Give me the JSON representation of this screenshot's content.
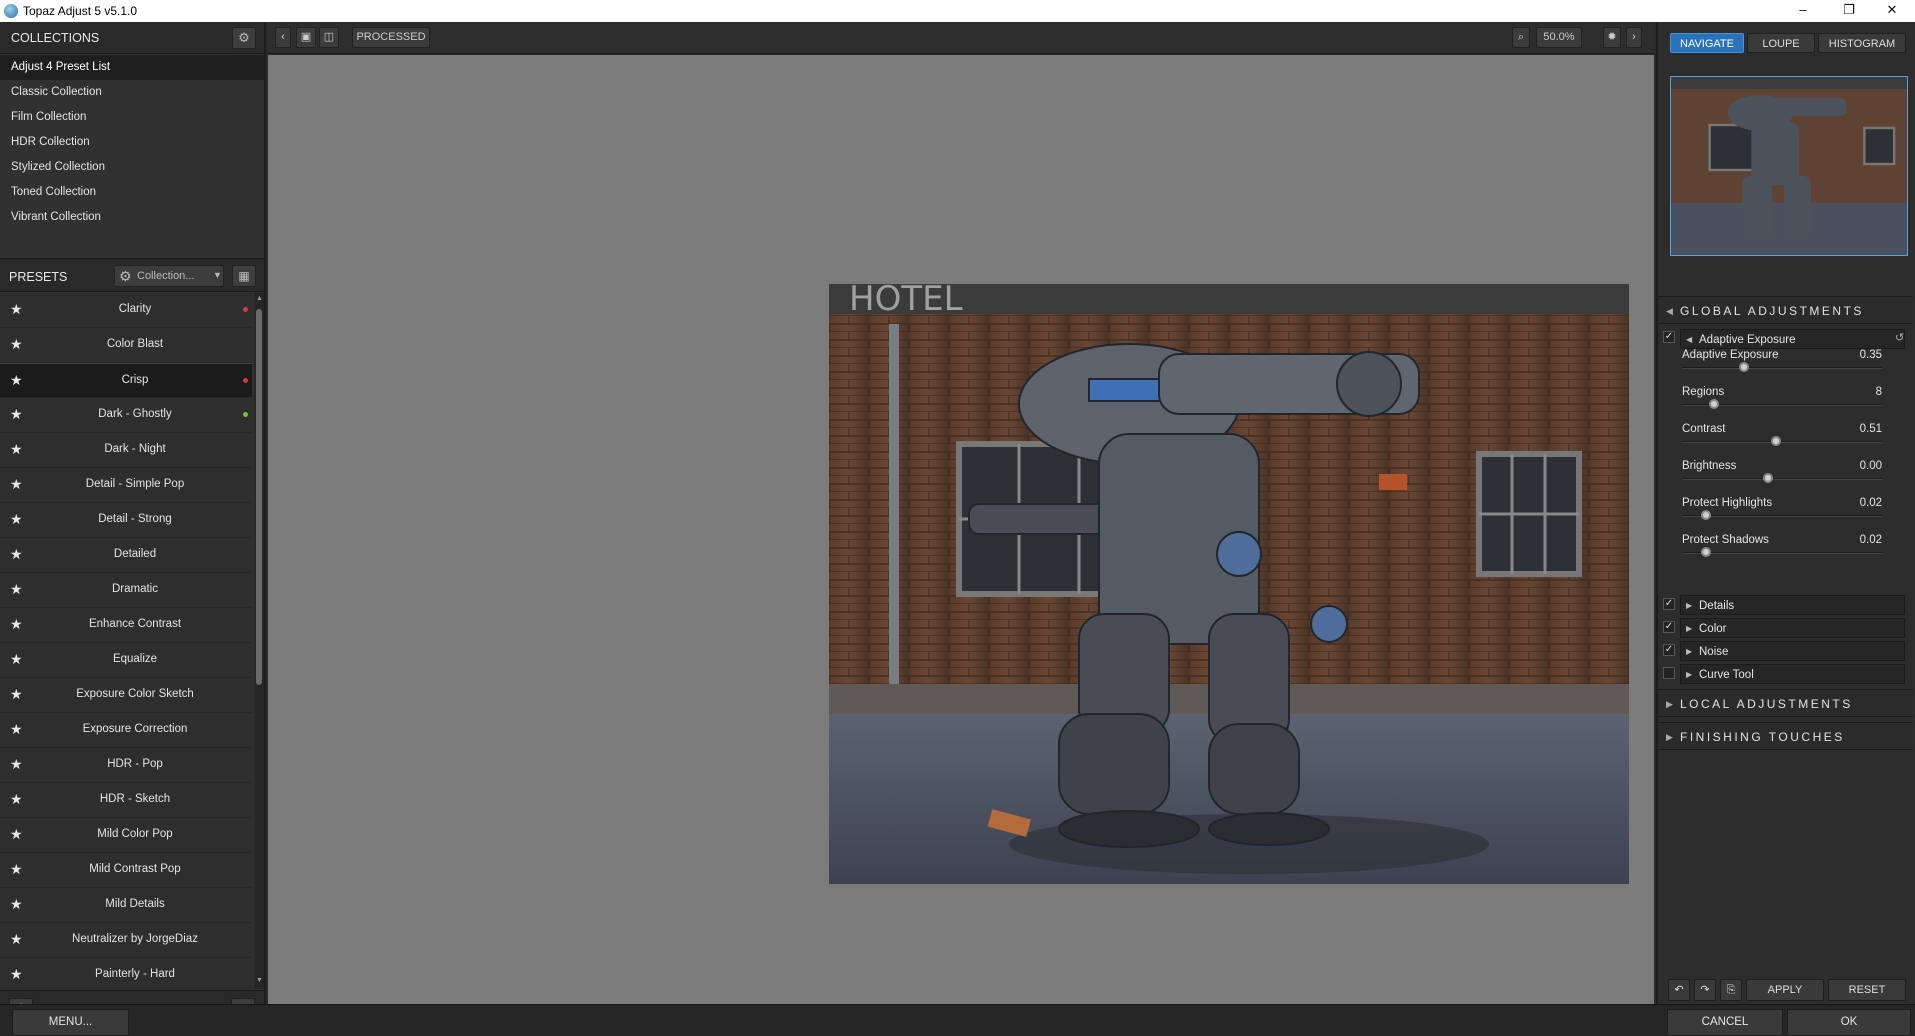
{
  "window": {
    "title": "Topaz Adjust 5 v5.1.0",
    "minimize": "–",
    "maximize": "❐",
    "close": "✕"
  },
  "collections": {
    "header": "COLLECTIONS",
    "items": [
      "Adjust 4 Preset List",
      "Classic Collection",
      "Film Collection",
      "HDR Collection",
      "Stylized Collection",
      "Toned Collection",
      "Vibrant Collection"
    ],
    "selected": "Adjust 4 Preset List"
  },
  "presets": {
    "header": "PRESETS",
    "filter_label": "Collection...",
    "items": [
      {
        "name": "Clarity",
        "dot": "#d43a3a"
      },
      {
        "name": "Color Blast",
        "dot": ""
      },
      {
        "name": "Crisp",
        "dot": "#d43a3a",
        "selected": true
      },
      {
        "name": "Dark - Ghostly",
        "dot": "#7ac143"
      },
      {
        "name": "Dark - Night",
        "dot": ""
      },
      {
        "name": "Detail - Simple Pop",
        "dot": ""
      },
      {
        "name": "Detail - Strong",
        "dot": ""
      },
      {
        "name": "Detailed",
        "dot": ""
      },
      {
        "name": "Dramatic",
        "dot": ""
      },
      {
        "name": "Enhance Contrast",
        "dot": ""
      },
      {
        "name": "Equalize",
        "dot": ""
      },
      {
        "name": "Exposure Color Sketch",
        "dot": ""
      },
      {
        "name": "Exposure Correction",
        "dot": ""
      },
      {
        "name": "HDR - Pop",
        "dot": ""
      },
      {
        "name": "HDR - Sketch",
        "dot": ""
      },
      {
        "name": "Mild Color Pop",
        "dot": ""
      },
      {
        "name": "Mild Contrast Pop",
        "dot": ""
      },
      {
        "name": "Mild Details",
        "dot": ""
      },
      {
        "name": "Neutralizer by JorgeDiaz",
        "dot": ""
      },
      {
        "name": "Painterly - Hard",
        "dot": ""
      }
    ]
  },
  "toolbar": {
    "mode_label": "PROCESSED",
    "zoom": "50.0%"
  },
  "right_tabs": [
    "NAVIGATE",
    "LOUPE",
    "HISTOGRAM"
  ],
  "global_adjustments": {
    "header": "GLOBAL ADJUSTMENTS",
    "adaptive_exposure": {
      "title": "Adaptive Exposure",
      "sliders": [
        {
          "label": "Adaptive Exposure",
          "value": "0.35",
          "pos": 0.31
        },
        {
          "label": "Regions",
          "value": "8",
          "pos": 0.16
        },
        {
          "label": "Contrast",
          "value": "0.51",
          "pos": 0.47
        },
        {
          "label": "Brightness",
          "value": "0.00",
          "pos": 0.43
        },
        {
          "label": "Protect Highlights",
          "value": "0.02",
          "pos": 0.12
        },
        {
          "label": "Protect Shadows",
          "value": "0.02",
          "pos": 0.12
        }
      ]
    },
    "subsections": [
      {
        "label": "Details",
        "checked": true
      },
      {
        "label": "Color",
        "checked": true
      },
      {
        "label": "Noise",
        "checked": true
      },
      {
        "label": "Curve Tool",
        "checked": false
      }
    ]
  },
  "local_adjustments": {
    "header": "LOCAL ADJUSTMENTS"
  },
  "finishing_touches": {
    "header": "FINISHING TOUCHES"
  },
  "right_footer": {
    "apply": "APPLY",
    "reset": "RESET"
  },
  "bottom": {
    "menu": "MENU...",
    "cancel": "CANCEL",
    "ok": "OK"
  }
}
